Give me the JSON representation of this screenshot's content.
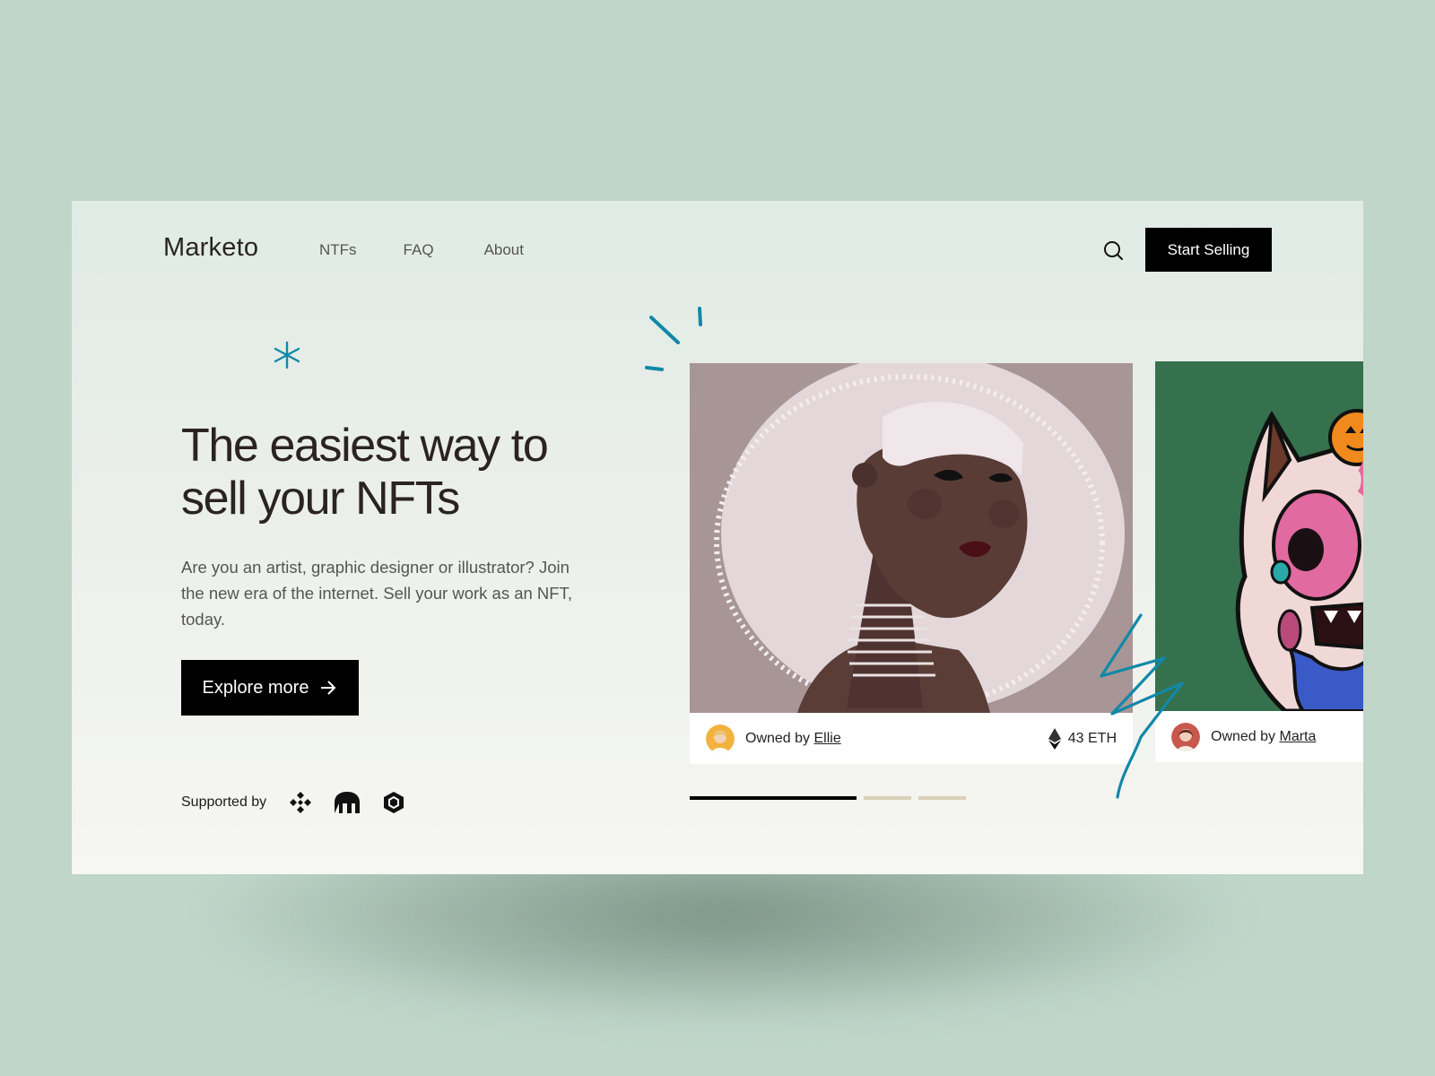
{
  "header": {
    "logo": "Marketo",
    "nav": [
      "NTFs",
      "FAQ",
      "About"
    ],
    "start_selling": "Start Selling"
  },
  "hero": {
    "title": "The easiest way to sell your NFTs",
    "description": "Are you an artist, graphic designer or illustrator? Join the new era of the internet. Sell your work as an NFT, today.",
    "cta": "Explore more",
    "supported_by": "Supported by",
    "partner_icons": [
      "binance-icon",
      "kraken-icon",
      "crypto-com-icon"
    ]
  },
  "cards": [
    {
      "owned_by": "Owned by",
      "owner": "Ellie",
      "price": "43 ETH",
      "icon": "ethereum-icon"
    },
    {
      "owned_by": "Owned by",
      "owner": "Marta"
    }
  ],
  "carousel": {
    "slides": 3,
    "active_index": 0
  },
  "colors": {
    "page_background": "#bfd6c9",
    "accent": "#1188a8",
    "button": "#000000",
    "progress_active": "#000000",
    "progress_inactive": "#d8d0b8",
    "card2_background": "#35714c"
  }
}
